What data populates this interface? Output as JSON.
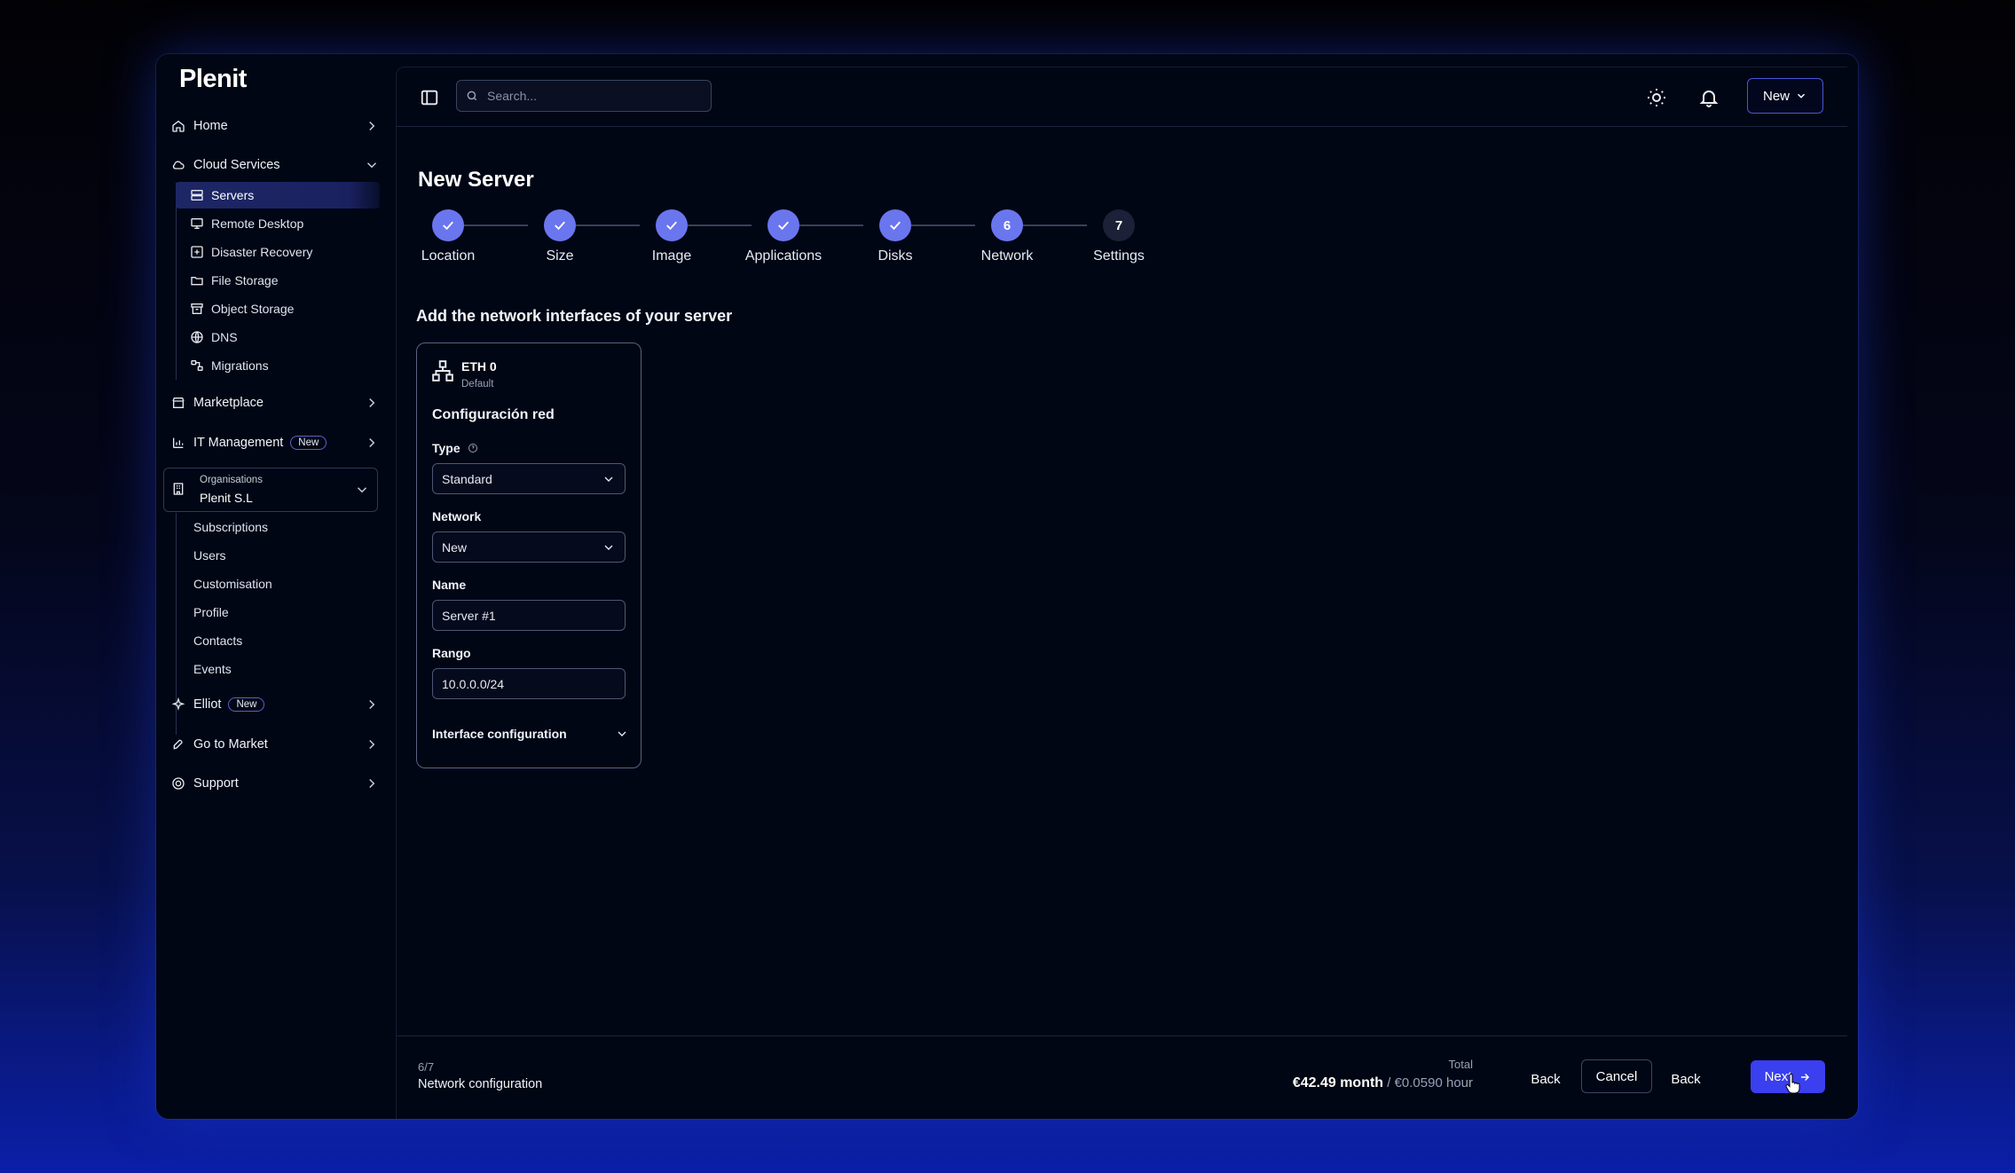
{
  "sidebar": {
    "logo": "Plenit",
    "home": "Home",
    "cloud_services": "Cloud Services",
    "cloud_items": [
      "Servers",
      "Remote Desktop",
      "Disaster Recovery",
      "File Storage",
      "Object Storage",
      "DNS",
      "Migrations"
    ],
    "marketplace": "Marketplace",
    "it_management": "IT Management",
    "it_badge": "New",
    "org_label": "Organisations",
    "org_name": "Plenit S.L",
    "org_items": [
      "Subscriptions",
      "Users",
      "Customisation",
      "Profile",
      "Contacts",
      "Events"
    ],
    "elliot": "Elliot",
    "elliot_badge": "New",
    "go_to_market": "Go to Market",
    "support": "Support"
  },
  "topbar": {
    "search_placeholder": "Search...",
    "new_label": "New"
  },
  "page": {
    "title": "New Server",
    "steps": [
      {
        "label": "Location",
        "state": "done"
      },
      {
        "label": "Size",
        "state": "done"
      },
      {
        "label": "Image",
        "state": "done"
      },
      {
        "label": "Applications",
        "state": "done"
      },
      {
        "label": "Disks",
        "state": "done"
      },
      {
        "label": "Network",
        "state": "current",
        "number": "6"
      },
      {
        "label": "Settings",
        "state": "todo",
        "number": "7"
      }
    ],
    "section_title": "Add the network interfaces of your server"
  },
  "card": {
    "title": "ETH 0",
    "subtitle": "Default",
    "config_title": "Configuración red",
    "type_label": "Type",
    "type_value": "Standard",
    "network_label": "Network",
    "network_value": "New",
    "name_label": "Name",
    "name_value": "Server #1",
    "range_label": "Rango",
    "range_value": "10.0.0.0/24",
    "interface_config": "Interface configuration"
  },
  "footer": {
    "step": "6/7",
    "step_name": "Network configuration",
    "total_label": "Total",
    "price_month": "€42.49 month",
    "price_hour": "/ €0.0590 hour",
    "back_label": "Back",
    "cancel_label": "Cancel",
    "back2_label": "Back",
    "next_label": "Next"
  },
  "colors": {
    "accent": "#6a76ee",
    "primary_button": "#3a3ff0",
    "background": "#000614"
  }
}
